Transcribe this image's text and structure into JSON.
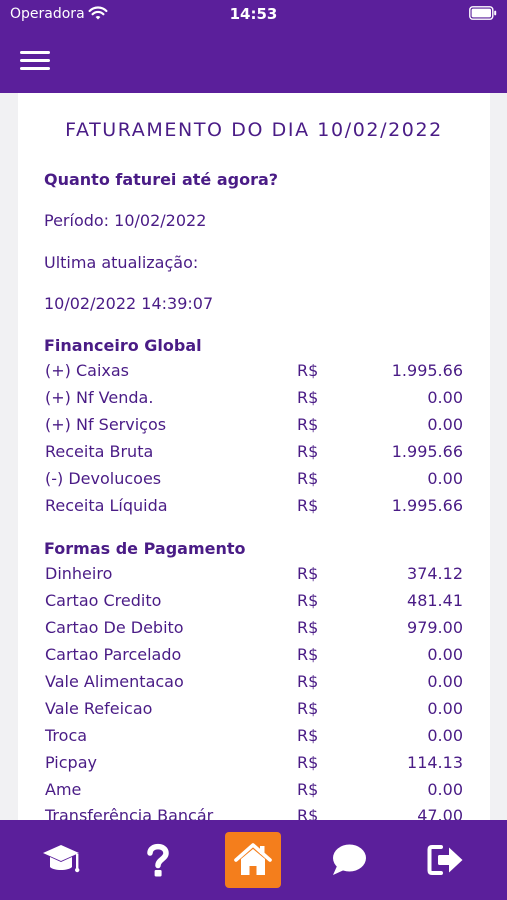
{
  "status_bar": {
    "carrier": "Operadora",
    "time": "14:53"
  },
  "header": {
    "menu_icon": "hamburger-menu-icon"
  },
  "title": "FATURAMENTO DO DIA 10/02/2022",
  "question": "Quanto faturei até agora?",
  "period": "Período: 10/02/2022",
  "last_update_label": "Ultima atualização:",
  "last_update_value": "10/02/2022 14:39:07",
  "financeiro": {
    "title": "Financeiro Global",
    "rows": [
      {
        "label": "(+) Caixas",
        "currency": "R$",
        "value": "1.995.66"
      },
      {
        "label": "(+) Nf Venda.",
        "currency": "R$",
        "value": "0.00"
      },
      {
        "label": "(+) Nf Serviços",
        "currency": "R$",
        "value": "0.00"
      },
      {
        "label": "Receita Bruta",
        "currency": "R$",
        "value": "1.995.66"
      },
      {
        "label": "(-) Devolucoes",
        "currency": "R$",
        "value": "0.00"
      },
      {
        "label": "Receita Líquida",
        "currency": "R$",
        "value": "1.995.66"
      }
    ]
  },
  "pagamentos": {
    "title": "Formas de Pagamento",
    "rows": [
      {
        "label": "Dinheiro",
        "currency": "R$",
        "value": "374.12"
      },
      {
        "label": "Cartao Credito",
        "currency": "R$",
        "value": "481.41"
      },
      {
        "label": "Cartao De Debito",
        "currency": "R$",
        "value": "979.00"
      },
      {
        "label": "Cartao Parcelado",
        "currency": "R$",
        "value": "0.00"
      },
      {
        "label": "Vale Alimentacao",
        "currency": "R$",
        "value": "0.00"
      },
      {
        "label": "Vale Refeicao",
        "currency": "R$",
        "value": "0.00"
      },
      {
        "label": "Troca",
        "currency": "R$",
        "value": "0.00"
      },
      {
        "label": "Picpay",
        "currency": "R$",
        "value": "114.13"
      },
      {
        "label": "Ame",
        "currency": "R$",
        "value": "0.00"
      },
      {
        "label": "Transferência Bancár",
        "currency": "R$",
        "value": "47.00"
      }
    ]
  },
  "bottom_nav": {
    "items": [
      "graduation-cap-icon",
      "question-mark-icon",
      "home-icon",
      "chat-bubble-icon",
      "sign-out-icon"
    ],
    "active": "home-icon"
  },
  "colors": {
    "brand": "#5b1f9b",
    "text": "#4a1c86",
    "accent": "#f47e1c"
  }
}
